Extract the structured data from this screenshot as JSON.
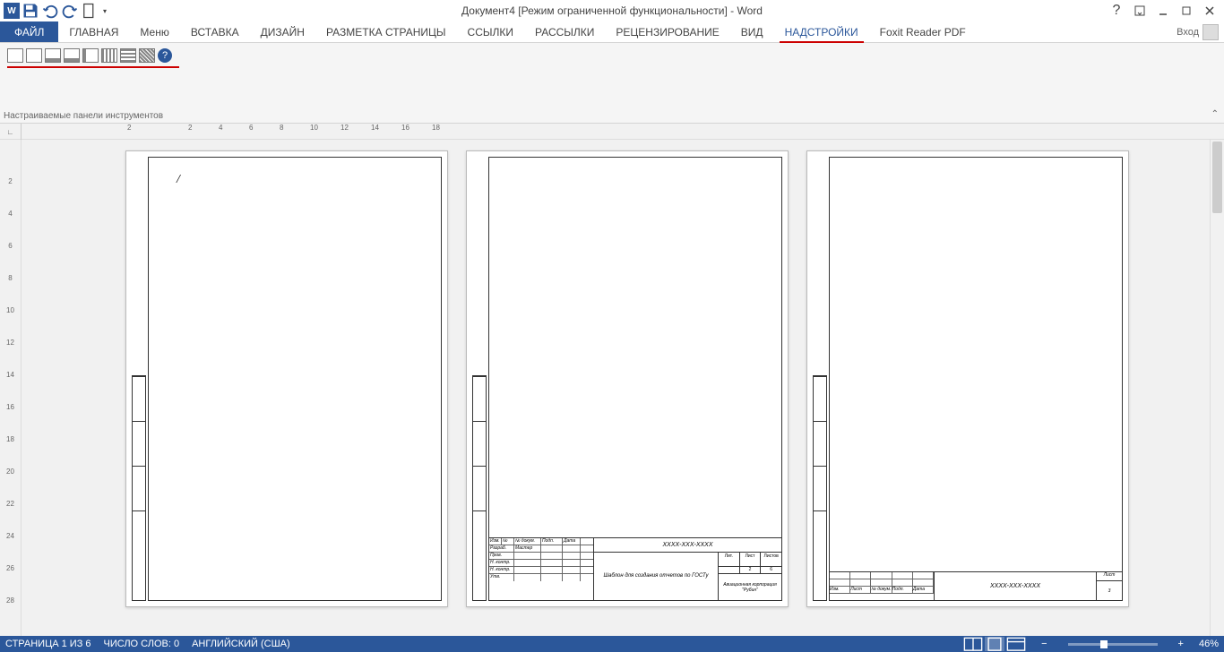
{
  "titlebar": {
    "app_icon_text": "W",
    "title": "Документ4 [Режим ограниченной функциональности] - Word"
  },
  "ribbon": {
    "tabs": {
      "file": "ФАЙЛ",
      "home": "ГЛАВНАЯ",
      "menu": "Меню",
      "insert": "ВСТАВКА",
      "design": "ДИЗАЙН",
      "layout": "РАЗМЕТКА СТРАНИЦЫ",
      "references": "ССЫЛКИ",
      "mailings": "РАССЫЛКИ",
      "review": "РЕЦЕНЗИРОВАНИЕ",
      "view": "ВИД",
      "addins": "НАДСТРОЙКИ",
      "foxit": "Foxit Reader PDF"
    },
    "signin": "Вход",
    "group_label": "Настраиваемые панели инструментов",
    "help_glyph": "?"
  },
  "ruler": {
    "h": [
      "2",
      "",
      "2",
      "4",
      "6",
      "8",
      "10",
      "12",
      "14",
      "16",
      "18"
    ]
  },
  "vruler": [
    "",
    "2",
    "4",
    "6",
    "8",
    "10",
    "12",
    "14",
    "16",
    "18",
    "20",
    "22",
    "24",
    "26",
    "28"
  ],
  "document": {
    "page1": {
      "cursor": "/"
    },
    "title_block": {
      "code": "ХХХХ-ХХХ-ХХХХ",
      "desc": "Шаблон для создания отчетов по ГОСТу",
      "org": "Авиационная корпорация \"Рубин\"",
      "cols": {
        "lit": "Лит.",
        "list": "Лист",
        "listov": "Листов"
      },
      "vals": {
        "list": "2",
        "listov": "6"
      },
      "left_rows": [
        "Изм.",
        "Разраб.",
        "Пров.",
        "Н. контр.",
        "Н. контр.",
        "Утв."
      ],
      "left_hdr": [
        "№",
        "№ докум.",
        "Подп.",
        "Дата"
      ],
      "left_r2": [
        "Мастер"
      ]
    },
    "title_block3": {
      "code": "ХХХХ-ХХХ-ХХХХ",
      "sheet_label": "Лист",
      "sheet_num": "3",
      "hdr": [
        "Изм.",
        "Лист",
        "№ докум.",
        "Подп.",
        "Дата"
      ]
    }
  },
  "statusbar": {
    "page": "СТРАНИЦА 1 ИЗ 6",
    "words": "ЧИСЛО СЛОВ: 0",
    "lang": "АНГЛИЙСКИЙ (США)",
    "zoom": "46%",
    "minus": "−",
    "plus": "+"
  }
}
